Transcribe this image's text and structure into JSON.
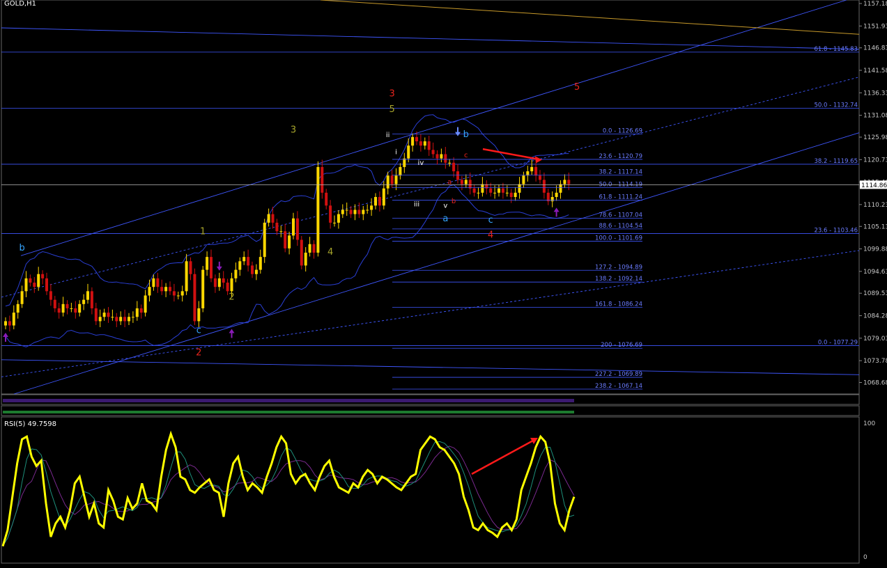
{
  "window": {
    "title": "GOLD,H1"
  },
  "rsi": {
    "title": "RSI(5) 49.7598",
    "levels": [
      "100",
      "0"
    ]
  },
  "colors": {
    "background": "#000000",
    "bull_candle": "#ffd700",
    "bear_candle": "#d01010",
    "channel": "#3f57ff",
    "fib": "#3f57ff",
    "rsi_line": "#ffff00",
    "wave_red": "#e8241d",
    "wave_yellow": "#a7a52b",
    "wave_cyan": "#34a4ff",
    "arrow": "#ff1a1a",
    "marker": "#8a1bb8"
  },
  "icons": [
    "purple-up-arrow-icon",
    "purple-down-arrow-icon",
    "blue-down-arrow-icon",
    "red-arrow-icon"
  ],
  "chart_data": [
    {
      "type": "candlestick",
      "title": "GOLD,H1",
      "ylim": [
        1066.0,
        1158.0
      ],
      "y_ticks": [
        "1157.18",
        "1151.93",
        "1146.83",
        "1141.58",
        "1136.33",
        "1131.08",
        "1125.98",
        "1120.73",
        "1115.48",
        "1110.23",
        "1105.13",
        "1099.88",
        "1094.63",
        "1089.53",
        "1084.28",
        "1079.03",
        "1073.78",
        "1068.68"
      ],
      "current_price": "1114.86",
      "prices": [
        1083,
        1082,
        1085,
        1087,
        1090,
        1093,
        1092,
        1091,
        1094,
        1093,
        1090,
        1088,
        1086,
        1085,
        1087,
        1086,
        1086,
        1085,
        1087,
        1088,
        1090,
        1086,
        1083,
        1084,
        1085,
        1084,
        1084,
        1083,
        1084,
        1083,
        1084,
        1084,
        1086,
        1085,
        1089,
        1091,
        1093,
        1091,
        1090,
        1091,
        1090,
        1089,
        1089,
        1090,
        1097,
        1094,
        1083,
        1086,
        1095,
        1098,
        1093,
        1091,
        1093,
        1092,
        1090,
        1093,
        1095,
        1097,
        1098,
        1096,
        1094,
        1095,
        1098,
        1106,
        1108,
        1106,
        1104,
        1104,
        1100,
        1103,
        1107,
        1102,
        1096,
        1099,
        1101,
        1099,
        1119,
        1113,
        1110,
        1106,
        1106,
        1108,
        1109,
        1109,
        1108,
        1109,
        1108,
        1109,
        1109,
        1110,
        1112,
        1110,
        1114,
        1117,
        1115,
        1117,
        1119,
        1121,
        1124,
        1126,
        1125,
        1124,
        1125,
        1123,
        1122,
        1121,
        1122,
        1120,
        1120,
        1118,
        1116,
        1115,
        1116,
        1114,
        1113,
        1113,
        1115,
        1114,
        1113,
        1113,
        1114,
        1113,
        1113,
        1112,
        1113,
        1115,
        1117,
        1118,
        1119,
        1117,
        1116,
        1113,
        1111,
        1112,
        1113,
        1115,
        1116,
        1115
      ],
      "fibonacci_left": [
        {
          "label": "0.0 - 1126.69",
          "value": 1126.69
        },
        {
          "label": "23.6 - 1120.79",
          "value": 1120.79
        },
        {
          "label": "38.2 - 1117.14",
          "value": 1117.14
        },
        {
          "label": "50.0 - 1114.19",
          "value": 1114.19
        },
        {
          "label": "61.8 - 1111.24",
          "value": 1111.24
        },
        {
          "label": "78.6 - 1107.04",
          "value": 1107.04
        },
        {
          "label": "88.6 - 1104.54",
          "value": 1104.54
        },
        {
          "label": "100.0 - 1101.69",
          "value": 1101.69
        },
        {
          "label": "127.2 - 1094.89",
          "value": 1094.89
        },
        {
          "label": "138.2 - 1092.14",
          "value": 1092.14
        },
        {
          "label": "161.8 - 1086.24",
          "value": 1086.24
        },
        {
          "label": "200 - 1076.69",
          "value": 1076.69
        },
        {
          "label": "227.2 - 1069.89",
          "value": 1069.89
        },
        {
          "label": "238.2 - 1067.14",
          "value": 1067.14
        }
      ],
      "fibonacci_right": [
        {
          "label": "61.8 - 1145.83",
          "value": 1145.83
        },
        {
          "label": "50.0 - 1132.74",
          "value": 1132.74
        },
        {
          "label": "38.2 - 1119.65",
          "value": 1119.65
        },
        {
          "label": "23.6 - 1103.46",
          "value": 1103.46
        },
        {
          "label": "0.0 - 1077.29",
          "value": 1077.29
        }
      ],
      "wave_labels": [
        {
          "text": "b",
          "color": "cyan",
          "bar": 4,
          "price": 1099.5
        },
        {
          "text": "c",
          "color": "cyan",
          "bar": 47,
          "price": 1080.2
        },
        {
          "text": "2",
          "color": "red",
          "bar": 47,
          "price": 1075.0
        },
        {
          "text": "1",
          "color": "yellow",
          "bar": 48,
          "price": 1103.3
        },
        {
          "text": "2",
          "color": "yellow",
          "bar": 55,
          "price": 1088.0
        },
        {
          "text": "3",
          "color": "yellow",
          "bar": 70,
          "price": 1127.0
        },
        {
          "text": "4",
          "color": "yellow",
          "bar": 79,
          "price": 1098.5
        },
        {
          "text": "5",
          "color": "yellow",
          "bar": 94,
          "price": 1131.8
        },
        {
          "text": "3",
          "color": "red",
          "bar": 94,
          "price": 1135.5
        },
        {
          "text": "ii",
          "color": "white",
          "bar": 93,
          "price": 1126.0
        },
        {
          "text": "i",
          "color": "white",
          "bar": 95,
          "price": 1122.0
        },
        {
          "text": "iv",
          "color": "white",
          "bar": 101,
          "price": 1119.5
        },
        {
          "text": "iii",
          "color": "white",
          "bar": 100,
          "price": 1109.8
        },
        {
          "text": "v",
          "color": "white",
          "bar": 107,
          "price": 1109.5
        },
        {
          "text": "a",
          "color": "red",
          "bar": 108,
          "price": 1115.0
        },
        {
          "text": "b",
          "color": "red",
          "bar": 109,
          "price": 1110.5
        },
        {
          "text": "c",
          "color": "red",
          "bar": 112,
          "price": 1121.3
        },
        {
          "text": "b",
          "color": "cyan",
          "bar": 112,
          "price": 1126.0
        },
        {
          "text": "a",
          "color": "cyan",
          "bar": 107,
          "price": 1106.3
        },
        {
          "text": "c",
          "color": "cyan",
          "bar": 118,
          "price": 1106.0
        },
        {
          "text": "4",
          "color": "red",
          "bar": 118,
          "price": 1102.5
        },
        {
          "text": "5",
          "color": "red",
          "bar": 139,
          "price": 1137.0
        }
      ]
    },
    {
      "type": "line",
      "title": "RSI(5) 49.7598",
      "ylim": [
        0,
        100
      ],
      "series": [
        {
          "values": [
            8,
            20,
            45,
            70,
            88,
            90,
            75,
            68,
            72,
            40,
            15,
            25,
            30,
            22,
            35,
            55,
            60,
            45,
            30,
            40,
            25,
            22,
            50,
            42,
            30,
            28,
            44,
            36,
            40,
            55,
            42,
            40,
            35,
            60,
            80,
            92,
            82,
            60,
            58,
            50,
            48,
            52,
            55,
            58,
            50,
            48,
            30,
            55,
            70,
            75,
            60,
            50,
            55,
            52,
            48,
            60,
            70,
            82,
            90,
            85,
            62,
            55,
            60,
            62,
            55,
            50,
            60,
            68,
            72,
            60,
            52,
            50,
            48,
            55,
            52,
            60,
            65,
            62,
            55,
            60,
            58,
            55,
            52,
            50,
            55,
            60,
            62,
            80,
            85,
            90,
            88,
            82,
            80,
            75,
            70,
            62,
            45,
            35,
            22,
            20,
            25,
            20,
            18,
            15,
            22,
            25,
            20,
            28,
            50,
            60,
            70,
            82,
            90,
            86,
            70,
            40,
            25,
            20,
            35,
            45
          ]
        }
      ]
    }
  ]
}
